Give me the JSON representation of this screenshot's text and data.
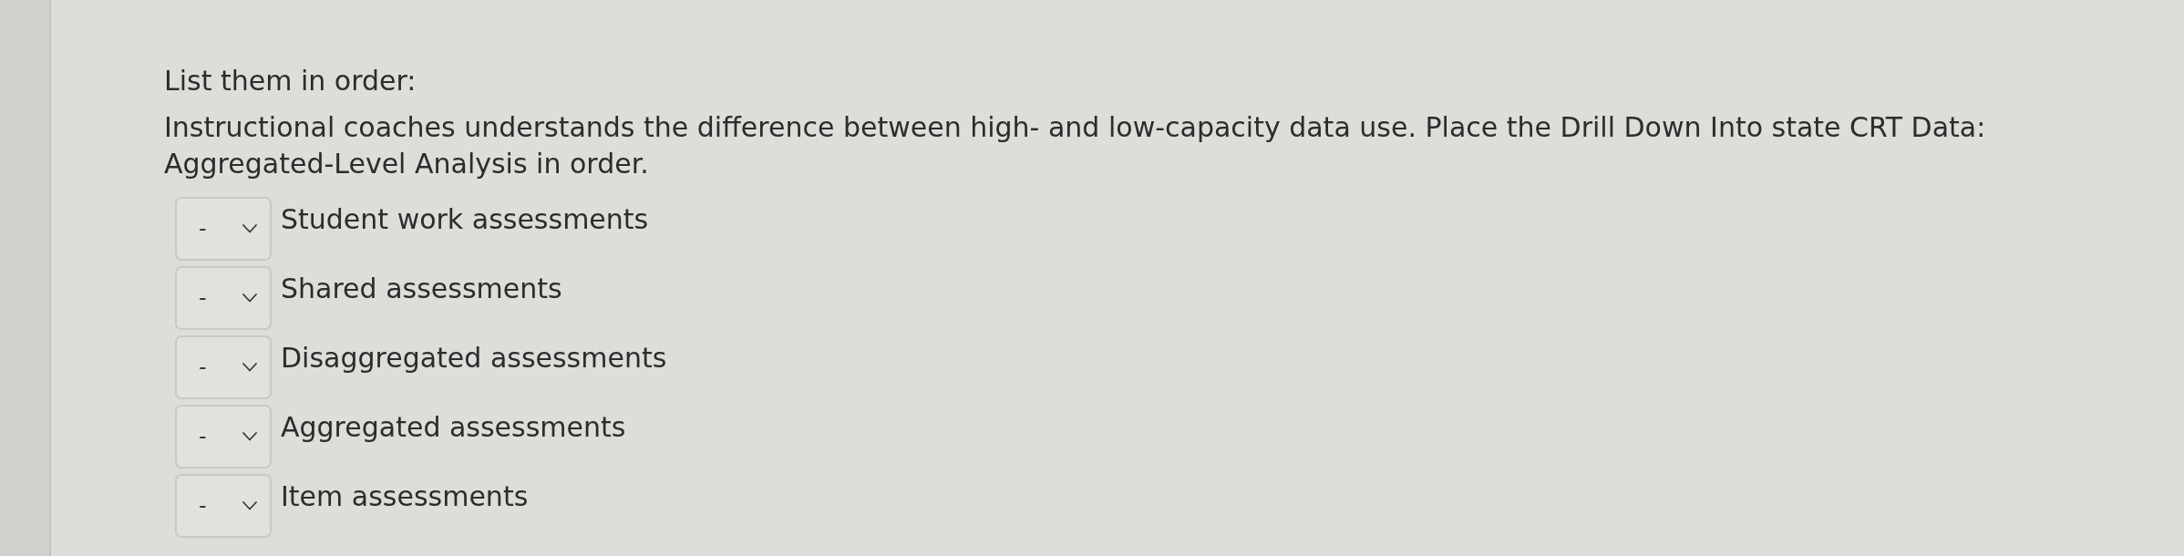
{
  "instructions": "List them in order:",
  "question": "Instructional coaches understands the difference between high- and low-capacity data use. Place the Drill Down Into state CRT Data: Aggregated-Level Analysis in order.",
  "items": [
    {
      "value": "-",
      "label": "Student work assessments"
    },
    {
      "value": "-",
      "label": "Shared assessments"
    },
    {
      "value": "-",
      "label": "Disaggregated assessments"
    },
    {
      "value": "-",
      "label": "Aggregated assessments"
    },
    {
      "value": "-",
      "label": "Item assessments"
    }
  ]
}
